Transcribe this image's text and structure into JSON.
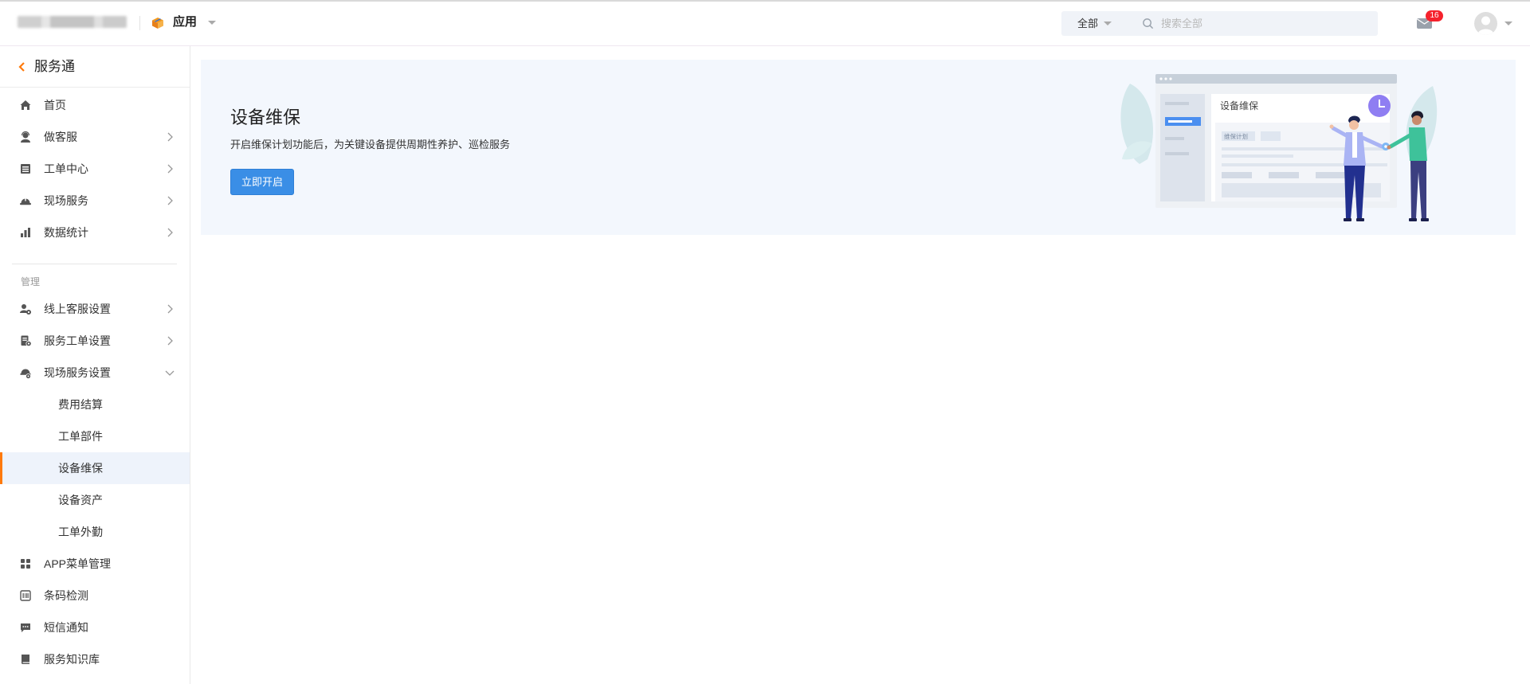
{
  "header": {
    "app_label": "应用",
    "search": {
      "scope": "全部",
      "placeholder": "搜索全部"
    },
    "notifications": {
      "badge_count": "16",
      "icon": "mail-icon"
    },
    "user": {
      "icon": "avatar-icon"
    }
  },
  "sidebar": {
    "title": "服务通",
    "menu": [
      {
        "label": "首页",
        "icon": "home-icon"
      },
      {
        "label": "做客服",
        "icon": "customer-service-icon"
      },
      {
        "label": "工单中心",
        "icon": "list-icon"
      },
      {
        "label": "现场服务",
        "icon": "helmet-icon"
      },
      {
        "label": "数据统计",
        "icon": "bar-chart-icon"
      }
    ],
    "section_label": "管理",
    "settings": [
      {
        "label": "线上客服设置",
        "icon": "user-settings-icon"
      },
      {
        "label": "服务工单设置",
        "icon": "file-settings-icon"
      },
      {
        "label": "现场服务设置",
        "icon": "gear-icon",
        "expanded": true
      }
    ],
    "sub_items": [
      {
        "label": "费用结算"
      },
      {
        "label": "工单部件"
      },
      {
        "label": "设备维保",
        "active": true
      },
      {
        "label": "设备资产"
      },
      {
        "label": "工单外勤"
      }
    ],
    "more": [
      {
        "label": "APP菜单管理",
        "icon": "grid-icon"
      },
      {
        "label": "条码检测",
        "icon": "barcode-icon"
      },
      {
        "label": "短信通知",
        "icon": "message-icon"
      },
      {
        "label": "服务知识库",
        "icon": "book-icon"
      }
    ]
  },
  "banner": {
    "title": "设备维保",
    "description": "开启维保计划功能后，为关键设备提供周期性养护、巡检服务",
    "button_label": "立即开启",
    "illustration": {
      "window_title": "设备维保",
      "tag": "维保计划"
    }
  },
  "colors": {
    "accent": "#ff7a0c",
    "primary_button": "#3a8ee6",
    "badge": "#f5222d",
    "banner_bg": "#f3f7fd",
    "active_row_bg": "#eef3fb"
  }
}
